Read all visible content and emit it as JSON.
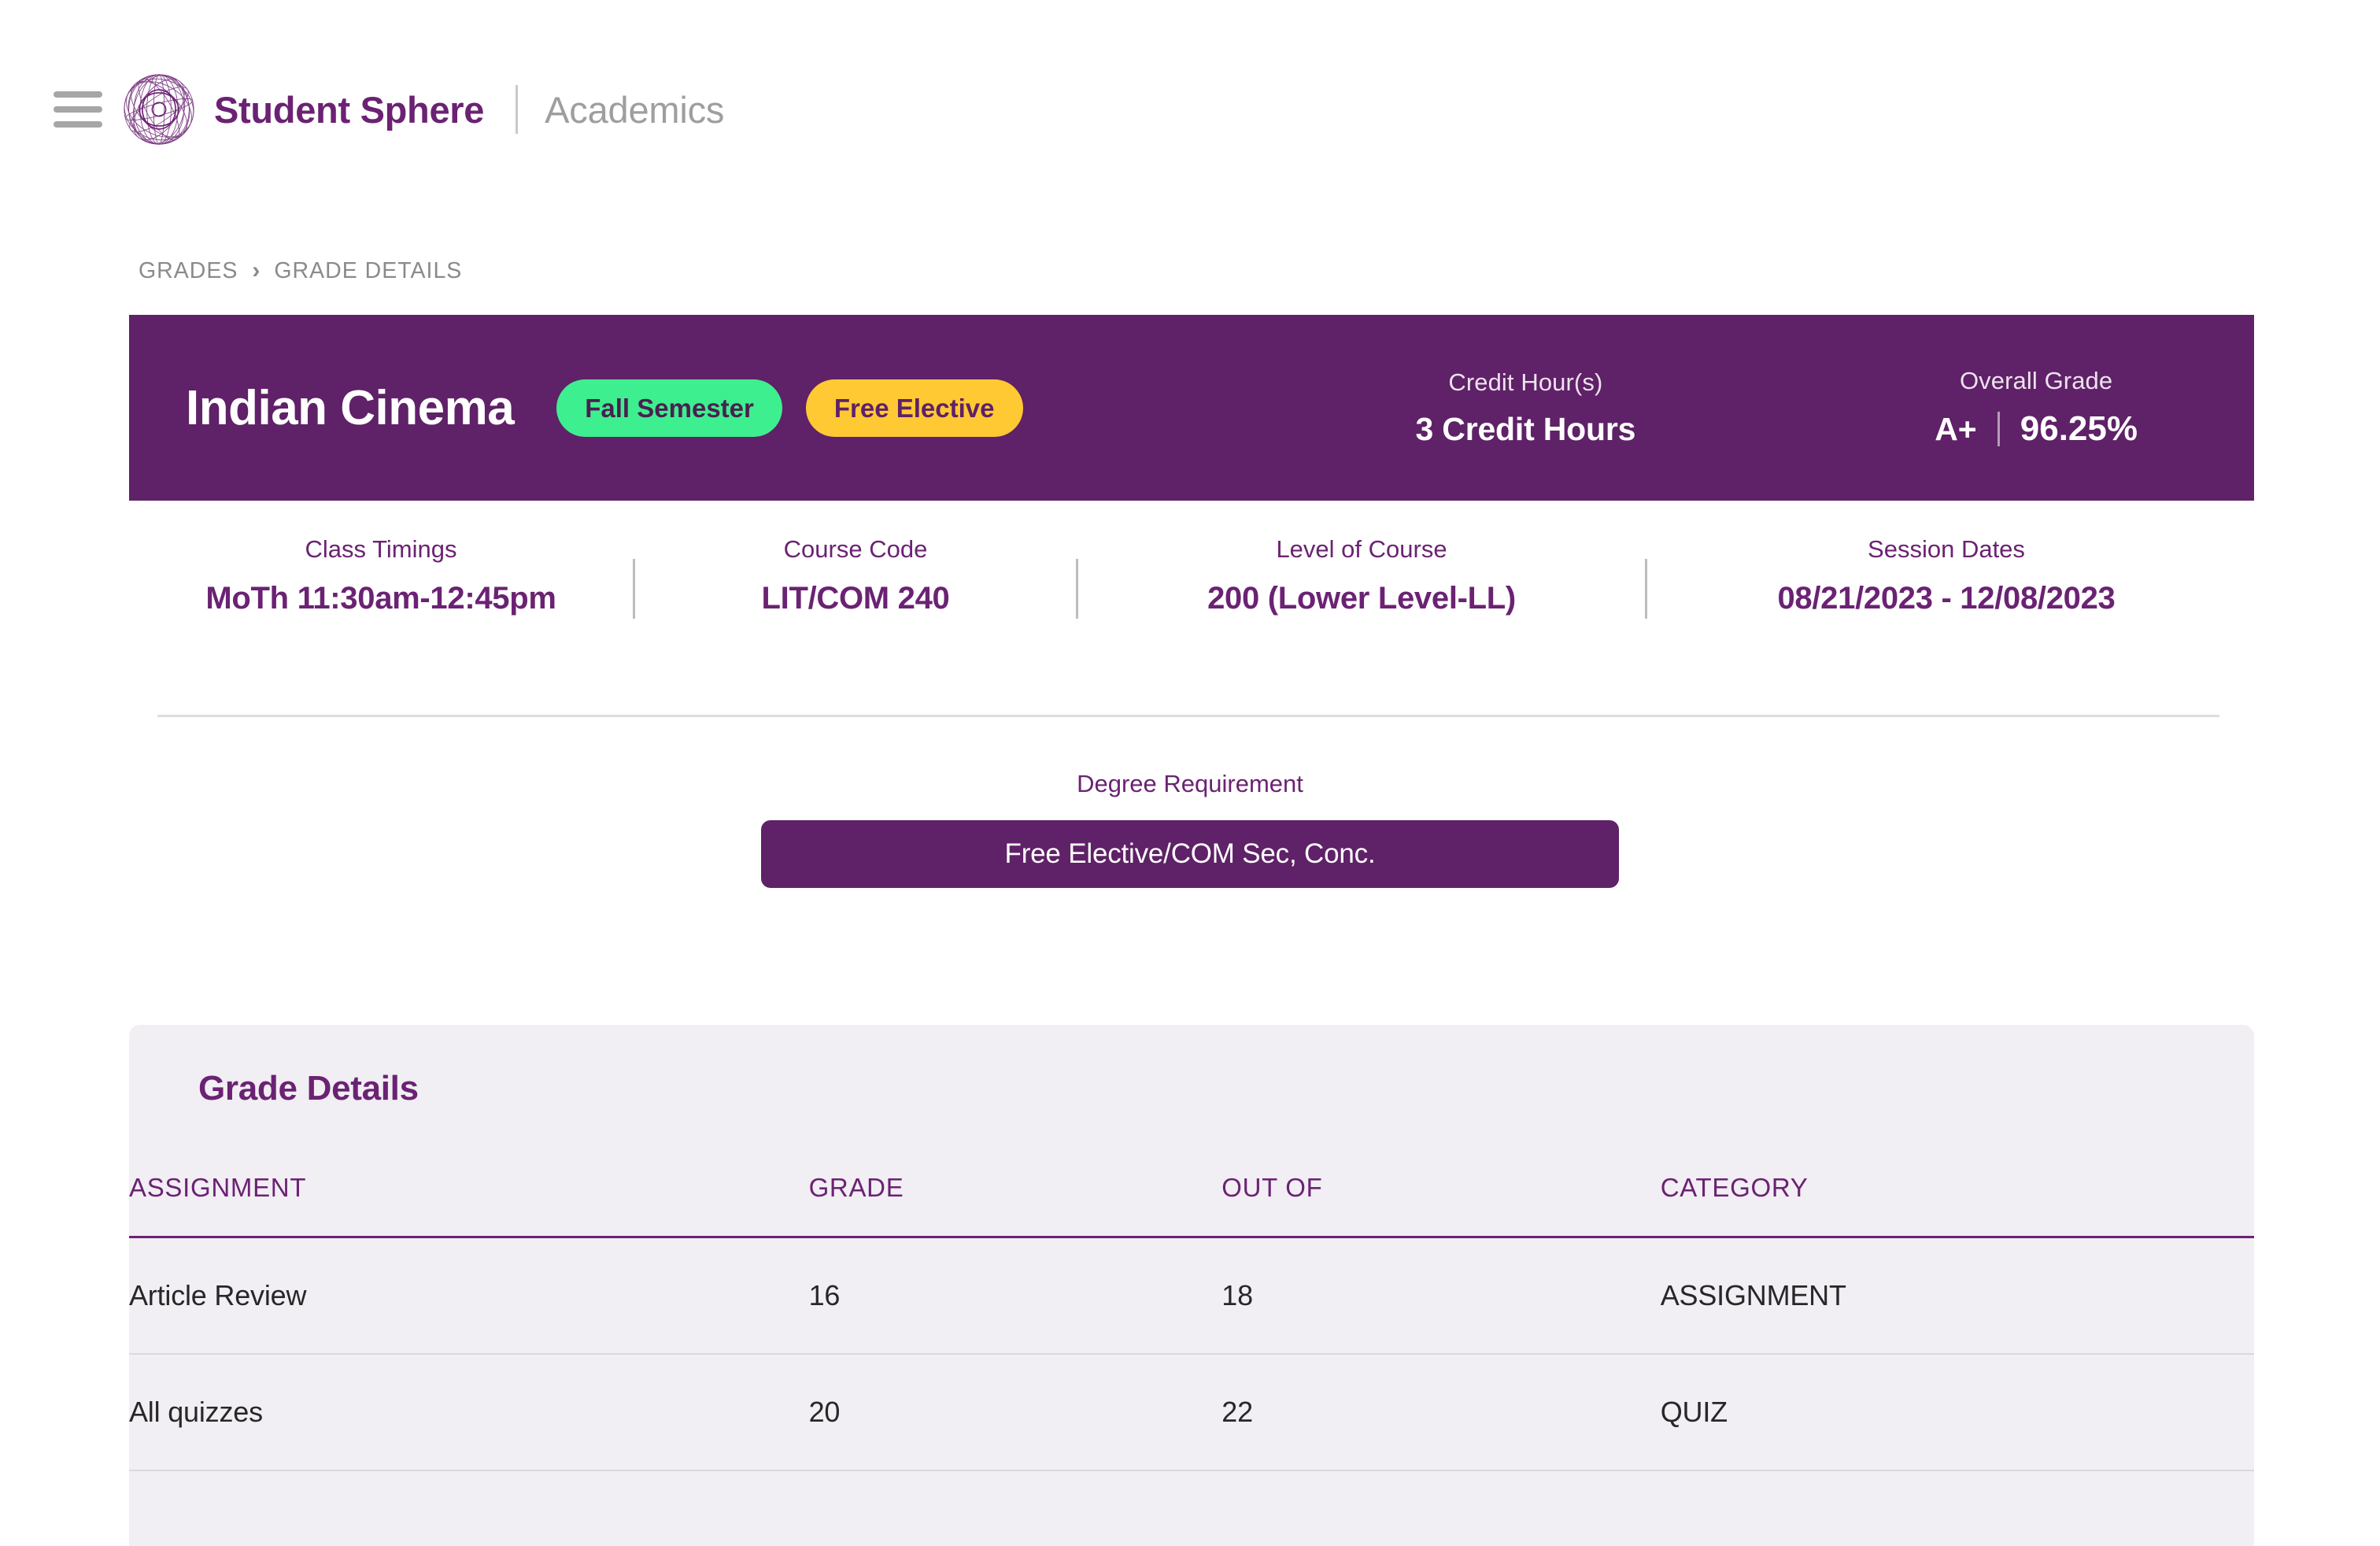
{
  "header": {
    "menu_icon": "hamburger-icon",
    "logo_icon": "sphere-logo-icon",
    "brand": "Student Sphere",
    "section": "Academics"
  },
  "breadcrumb": {
    "items": [
      "GRADES",
      "GRADE DETAILS"
    ],
    "separator_icon": "chevron-right-icon",
    "separator": "›"
  },
  "banner": {
    "course_title": "Indian Cinema",
    "pills": [
      {
        "label": "Fall Semester",
        "color": "#3eef8f"
      },
      {
        "label": "Free Elective",
        "color": "#ffc933"
      }
    ],
    "credit": {
      "label": "Credit Hour(s)",
      "value": "3 Credit Hours"
    },
    "overall": {
      "label": "Overall Grade",
      "letter": "A+",
      "percent": "96.25%"
    },
    "background": "#5f2167"
  },
  "info": {
    "timings": {
      "label": "Class Timings",
      "value": "MoTh 11:30am-12:45pm"
    },
    "code": {
      "label": "Course Code",
      "value": "LIT/COM 240"
    },
    "level": {
      "label": "Level of Course",
      "value": "200 (Lower Level-LL)"
    },
    "dates": {
      "label": "Session Dates",
      "value": "08/21/2023 - 12/08/2023"
    }
  },
  "degree": {
    "label": "Degree Requirement",
    "value": "Free Elective/COM Sec, Conc."
  },
  "grade_details": {
    "title": "Grade Details",
    "columns": [
      "ASSIGNMENT",
      "GRADE",
      "OUT OF",
      "CATEGORY"
    ],
    "rows": [
      {
        "assignment": "Article Review",
        "grade": "16",
        "out_of": "18",
        "category": "ASSIGNMENT"
      },
      {
        "assignment": "All quizzes",
        "grade": "20",
        "out_of": "22",
        "category": "QUIZ"
      }
    ]
  },
  "colors": {
    "brand_purple": "#6b2273",
    "banner_purple": "#5f2167",
    "card_bg": "#f1eef4",
    "accent_green": "#3eef8f",
    "accent_yellow": "#ffc933"
  }
}
